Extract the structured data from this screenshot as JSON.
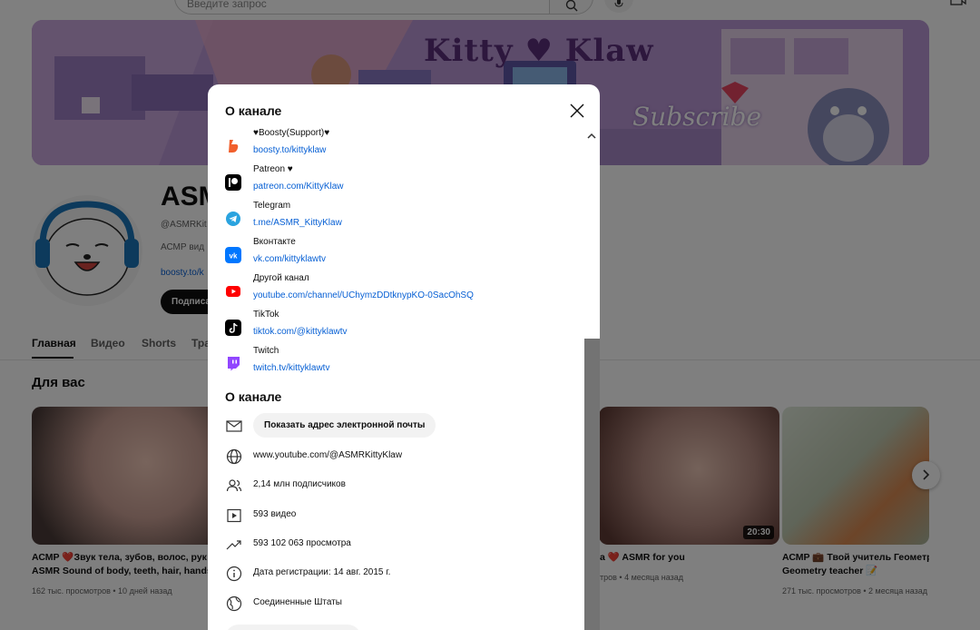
{
  "header": {
    "search_placeholder": "Введите запрос"
  },
  "banner": {
    "title": "Kitty ♥ Klaw",
    "subtitle": "Subscribe"
  },
  "channel": {
    "name": "ASMR",
    "handle": "@ASMRKit",
    "description": "АСМР вид",
    "link": "boosty.to/k",
    "subscribe_label": "Подписа"
  },
  "tabs": [
    {
      "label": "Главная"
    },
    {
      "label": "Видео"
    },
    {
      "label": "Shorts"
    },
    {
      "label": "Тра"
    }
  ],
  "section": {
    "title": "Для вас"
  },
  "videos": [
    {
      "title_line1": "АСМР ❤️Звук тела, зубов, волос, рук и",
      "title_line2": "ASMR Sound of body, teeth, hair, hands a",
      "meta": "162 тыс. просмотров • 10 дней назад"
    },
    {
      "title_line1": "a ❤️ ASMR for you",
      "title_line2": "",
      "meta": "тров • 4 месяца назад",
      "duration": "20:30"
    },
    {
      "title_line1": "АСМР 💼 Твой учитель Геометр",
      "title_line2": "Geometry teacher 📝",
      "meta": "271 тыс. просмотров • 2 месяца назад"
    }
  ],
  "modal": {
    "title": "О канале",
    "links": [
      {
        "title": "♥Boosty(Support)♥",
        "url": "boosty.to/kittyklaw",
        "icon": "boosty-icon",
        "color": "#f15f2c"
      },
      {
        "title": "Patreon ♥",
        "url": "patreon.com/KittyKlaw",
        "icon": "patreon-icon",
        "color": "#000000"
      },
      {
        "title": "Telegram",
        "url": "t.me/ASMR_KittyKlaw",
        "icon": "telegram-icon",
        "color": "#2aa3df"
      },
      {
        "title": "Вконтакте",
        "url": "vk.com/kittyklawtv",
        "icon": "vk-icon",
        "color": "#0077ff"
      },
      {
        "title": "Другой канал",
        "url": "youtube.com/channel/UChymzDDtknypKO-0SacOhSQ",
        "icon": "youtube-icon",
        "color": "#ff0000"
      },
      {
        "title": "TikTok",
        "url": "tiktok.com/@kittyklawtv",
        "icon": "tiktok-icon",
        "color": "#000000"
      },
      {
        "title": "Twitch",
        "url": "twitch.tv/kittyklawtv",
        "icon": "twitch-icon",
        "color": "#9146ff"
      }
    ],
    "about_title": "О канале",
    "email_button": "Показать адрес электронной почты",
    "info": {
      "url": "www.youtube.com/@ASMRKittyKlaw",
      "subscribers": "2,14 млн подписчиков",
      "videos": "593 видео",
      "views": "593 102 063 просмотра",
      "joined": "Дата регистрации: 14 авг. 2015 г.",
      "country": "Соединенные Штаты"
    }
  }
}
